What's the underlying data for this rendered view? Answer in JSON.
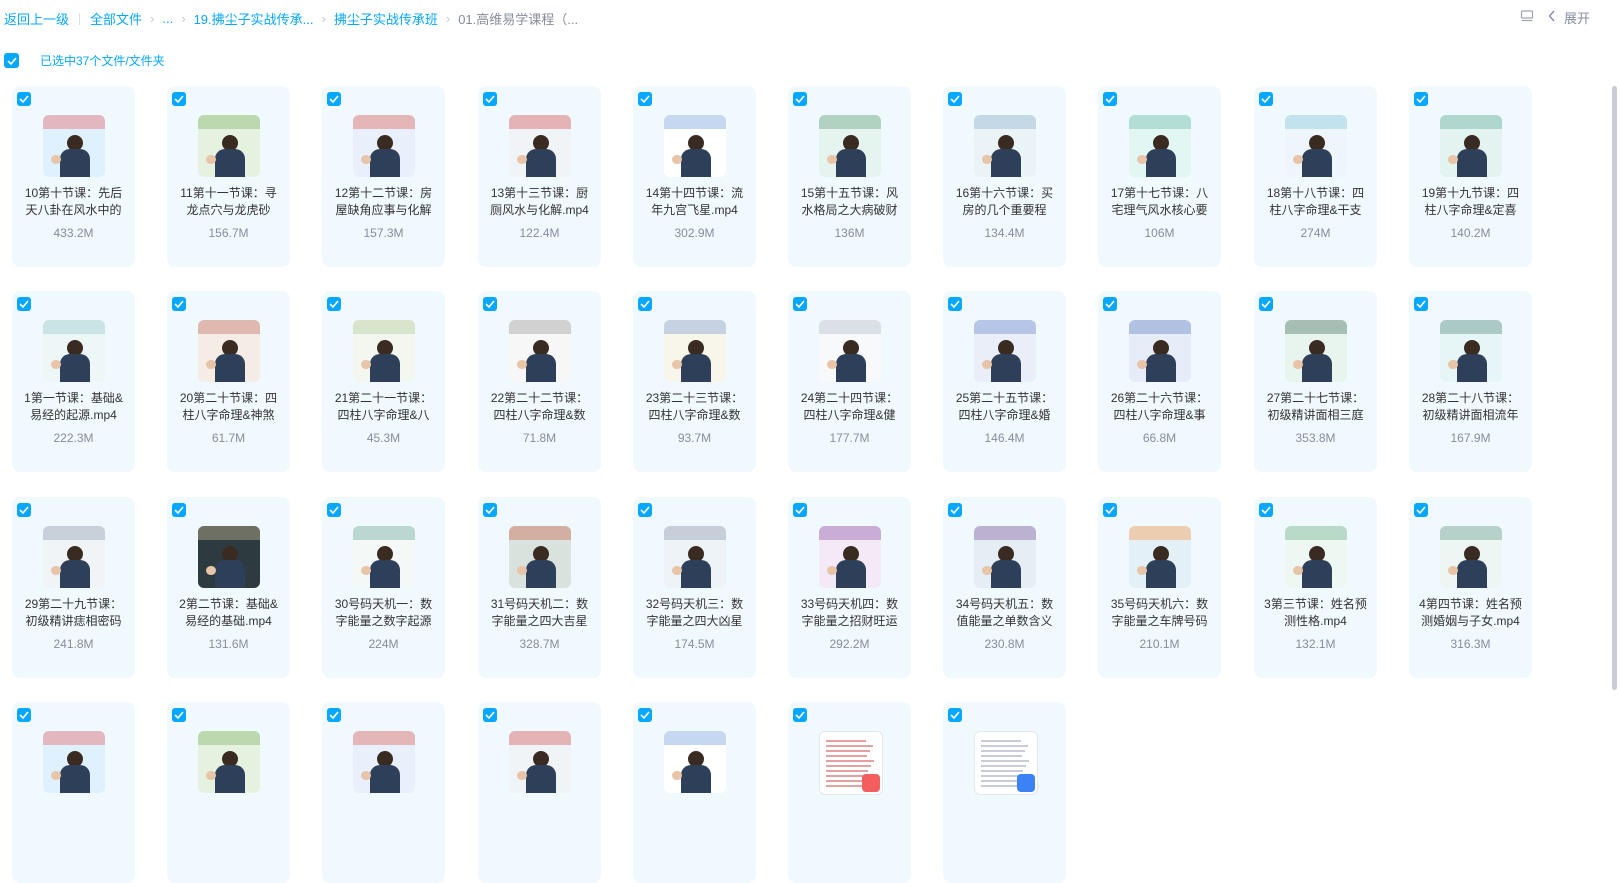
{
  "breadcrumb": {
    "back": "返回上一级",
    "items": [
      "全部文件",
      "...",
      "19.拂尘子实战传承...",
      "拂尘子实战传承班",
      "01.高维易学课程（..."
    ]
  },
  "toolbar": {
    "expand_label": "展开"
  },
  "selection": {
    "label": "已选中37个文件/文件夹"
  },
  "colors": {
    "accent": "#06a7ff",
    "card_bg": "#f0f9fe"
  },
  "files": [
    {
      "name": "10第十节课：先后天八卦在风水中的",
      "size": "433.2M"
    },
    {
      "name": "11第十一节课：寻龙点穴与龙虎砂",
      "size": "156.7M"
    },
    {
      "name": "12第十二节课：房屋缺角应事与化解",
      "size": "157.3M"
    },
    {
      "name": "13第十三节课：厨厕风水与化解.mp4",
      "size": "122.4M"
    },
    {
      "name": "14第十四节课：流年九宫飞星.mp4",
      "size": "302.9M"
    },
    {
      "name": "15第十五节课：风水格局之大病破财",
      "size": "136M"
    },
    {
      "name": "16第十六节课：买房的几个重要程",
      "size": "134.4M"
    },
    {
      "name": "17第十七节课：八宅理气风水核心要",
      "size": "106M"
    },
    {
      "name": "18第十八节课：四柱八字命理&干支",
      "size": "274M"
    },
    {
      "name": "19第十九节课：四柱八字命理&定喜",
      "size": "140.2M"
    },
    {
      "name": "1第一节课：基础&易经的起源.mp4",
      "size": "222.3M"
    },
    {
      "name": "20第二十节课：四柱八字命理&神煞",
      "size": "61.7M"
    },
    {
      "name": "21第二十一节课：四柱八字命理&八",
      "size": "45.3M"
    },
    {
      "name": "22第二十二节课：四柱八字命理&数",
      "size": "71.8M"
    },
    {
      "name": "23第二十三节课：四柱八字命理&数",
      "size": "93.7M"
    },
    {
      "name": "24第二十四节课：四柱八字命理&健",
      "size": "177.7M"
    },
    {
      "name": "25第二十五节课：四柱八字命理&婚",
      "size": "146.4M"
    },
    {
      "name": "26第二十六节课：四柱八字命理&事",
      "size": "66.8M"
    },
    {
      "name": "27第二十七节课：初级精讲面相三庭",
      "size": "353.8M"
    },
    {
      "name": "28第二十八节课：初级精讲面相流年",
      "size": "167.9M"
    },
    {
      "name": "29第二十九节课：初级精讲痣相密码",
      "size": "241.8M"
    },
    {
      "name": "2第二节课：基础&易经的基础.mp4",
      "size": "131.6M"
    },
    {
      "name": "30号码天机一：数字能量之数字起源",
      "size": "224M"
    },
    {
      "name": "31号码天机二：数字能量之四大吉星",
      "size": "328.7M"
    },
    {
      "name": "32号码天机三：数字能量之四大凶星",
      "size": "174.5M"
    },
    {
      "name": "33号码天机四：数字能量之招财旺运",
      "size": "292.2M"
    },
    {
      "name": "34号码天机五：数值能量之单数含义",
      "size": "230.8M"
    },
    {
      "name": "35号码天机六：数字能量之车牌号码",
      "size": "210.1M"
    },
    {
      "name": "3第三节课：姓名预测性格.mp4",
      "size": "132.1M"
    },
    {
      "name": "4第四节课：姓名预测婚姻与子女.mp4",
      "size": "316.3M"
    },
    {
      "name": "",
      "size": ""
    },
    {
      "name": "",
      "size": ""
    },
    {
      "name": "",
      "size": ""
    },
    {
      "name": "",
      "size": ""
    },
    {
      "name": "",
      "size": ""
    },
    {
      "name": "",
      "size": ""
    },
    {
      "name": "",
      "size": ""
    }
  ]
}
